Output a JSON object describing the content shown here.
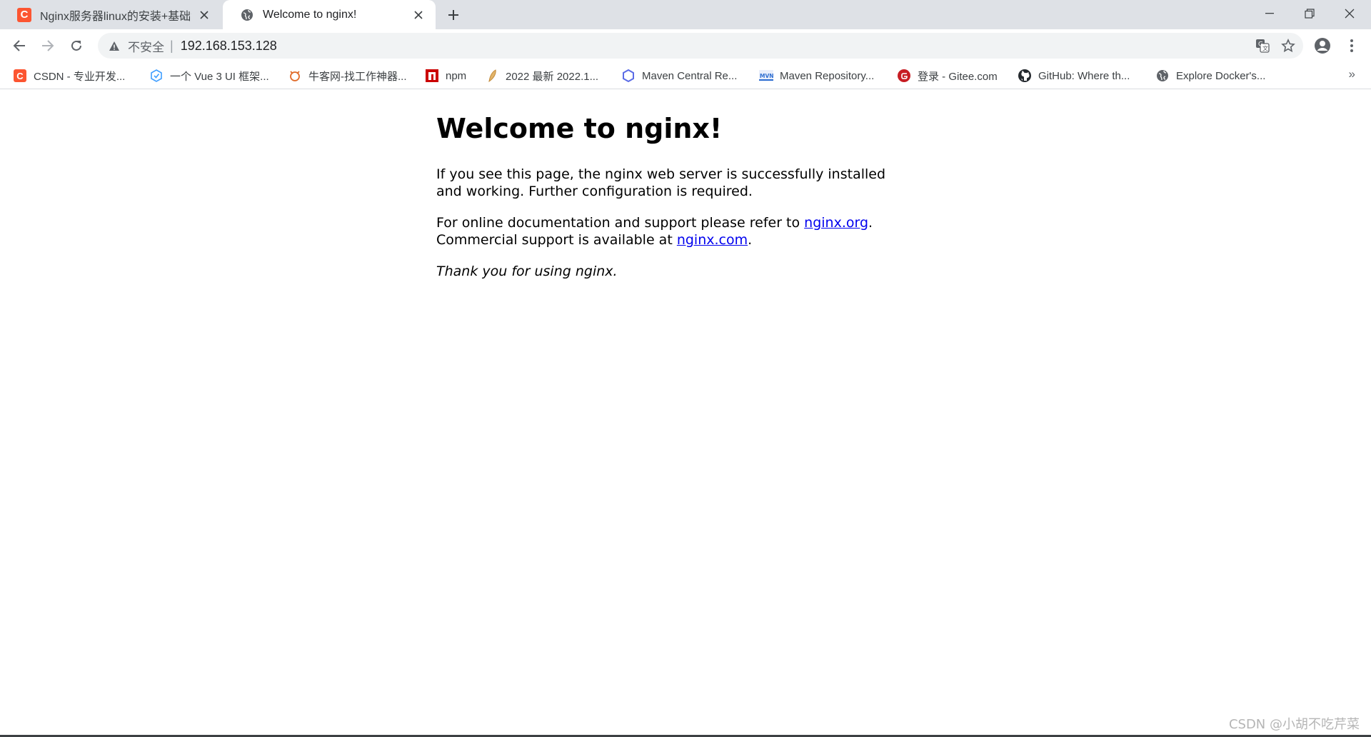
{
  "tabs": [
    {
      "title": "Nginx服务器linux的安装+基础命",
      "icon": "csdn-icon",
      "favicon_letter": "C",
      "active": false
    },
    {
      "title": "Welcome to nginx!",
      "icon": "globe-icon",
      "active": true
    }
  ],
  "window": {
    "minimize": "minimize-icon",
    "restore": "restore-icon",
    "close": "close-icon"
  },
  "address_bar": {
    "security_label": "不安全",
    "separator": "|",
    "url": "192.168.153.128"
  },
  "bookmarks": [
    {
      "label": "CSDN - 专业开发...",
      "icon": "csdn-icon",
      "letter": "C",
      "color": "#fc5531"
    },
    {
      "label": "一个 Vue 3 UI 框架...",
      "icon": "vue-ui-icon",
      "color": "#409eff"
    },
    {
      "label": "牛客网-找工作神器...",
      "icon": "nowcoder-icon",
      "color": "#e06a28"
    },
    {
      "label": "npm",
      "icon": "npm-icon",
      "color": "#cb0000"
    },
    {
      "label": "2022 最新 2022.1...",
      "icon": "feather-icon",
      "color": "#c28a3a"
    },
    {
      "label": "Maven Central Re...",
      "icon": "hexagon-icon",
      "color": "#5b6ce6"
    },
    {
      "label": "Maven Repository...",
      "icon": "mvn-icon",
      "color": "#2f6fd1"
    },
    {
      "label": "登录 - Gitee.com",
      "icon": "gitee-icon",
      "color": "#c71d23"
    },
    {
      "label": "GitHub: Where th...",
      "icon": "github-icon",
      "color": "#24292e"
    },
    {
      "label": "Explore Docker's...",
      "icon": "globe-icon",
      "color": "#5f6368"
    }
  ],
  "bookmarks_overflow": "»",
  "page": {
    "heading": "Welcome to nginx!",
    "para1": "If you see this page, the nginx web server is successfully installed and working. Further configuration is required.",
    "para2_prefix": "For online documentation and support please refer to ",
    "link1": "nginx.org",
    "para2_mid": ".",
    "para2_line2": "Commercial support is available at ",
    "link2": "nginx.com",
    "para2_end": ".",
    "thanks": "Thank you for using nginx."
  },
  "watermark": "CSDN @小胡不吃芹菜",
  "colors": {
    "link": "#0000ee",
    "tabstrip": "#dee1e6",
    "omnibox": "#f1f3f4"
  }
}
